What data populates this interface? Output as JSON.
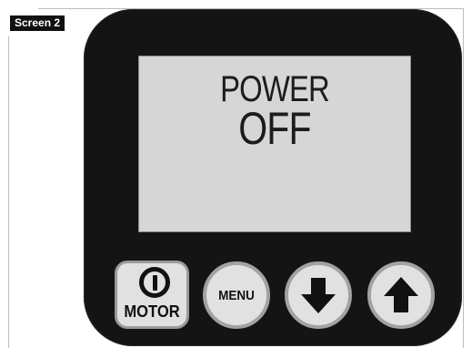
{
  "screen_tag": "Screen 2",
  "display": {
    "line1": "POWER",
    "line2": "OFF"
  },
  "buttons": {
    "motor": {
      "label": "MOTOR",
      "icon": "power-icon"
    },
    "menu": {
      "label": "MENU"
    },
    "down": {
      "icon": "down-arrow-icon"
    },
    "up": {
      "icon": "up-arrow-icon"
    }
  },
  "colors": {
    "device_body": "#141414",
    "lcd_background": "#d6d6d6",
    "button_face": "#e1e1e1",
    "button_border": "#a2a2a2"
  }
}
